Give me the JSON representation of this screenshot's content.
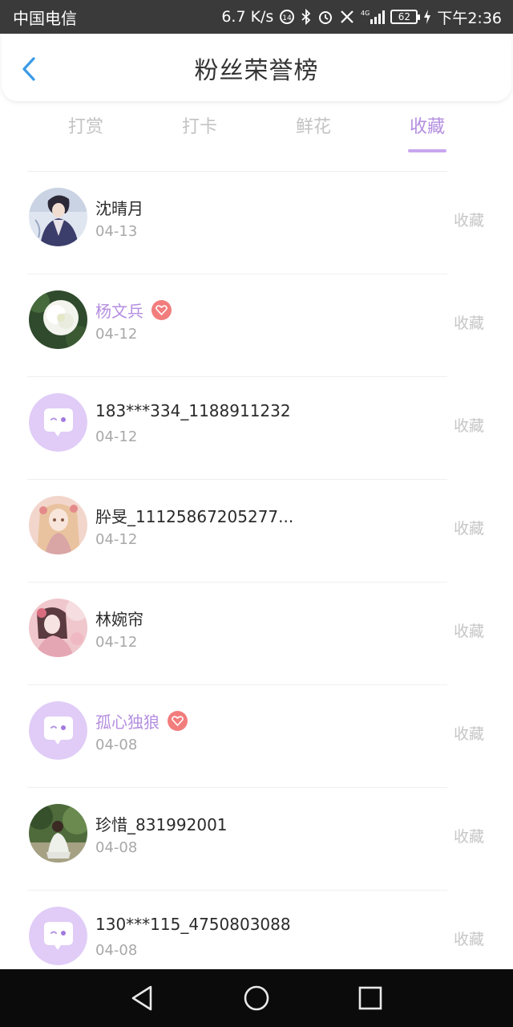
{
  "status_bar": {
    "carrier": "中国电信",
    "speed": "6.7 K/s",
    "battery": "62",
    "network": "4G",
    "time": "下午2:36"
  },
  "header": {
    "title": "粉丝荣誉榜",
    "back_icon": "back-chevron-icon"
  },
  "tabs": [
    {
      "label": "打赏",
      "active": false
    },
    {
      "label": "打卡",
      "active": false
    },
    {
      "label": "鲜花",
      "active": false
    },
    {
      "label": "收藏",
      "active": true
    }
  ],
  "list": [
    {
      "name": "沈晴月",
      "date": "04-13",
      "action": "收藏",
      "vip": false,
      "avatar": "photo-illustration-man"
    },
    {
      "name": "杨文兵",
      "date": "04-12",
      "action": "收藏",
      "vip": true,
      "avatar": "photo-white-flower"
    },
    {
      "name": "183***334_1188911232",
      "date": "04-12",
      "action": "收藏",
      "vip": false,
      "avatar": "default-chat-avatar"
    },
    {
      "name": "肸旻_11125867205277...",
      "date": "04-12",
      "action": "收藏",
      "vip": false,
      "avatar": "photo-illustration-girl"
    },
    {
      "name": "林婉帘",
      "date": "04-12",
      "action": "收藏",
      "vip": false,
      "avatar": "photo-illustration-pink"
    },
    {
      "name": "孤心独狼",
      "date": "04-08",
      "action": "收藏",
      "vip": true,
      "avatar": "default-chat-avatar"
    },
    {
      "name": "珍惜_831992001",
      "date": "04-08",
      "action": "收藏",
      "vip": false,
      "avatar": "photo-person-outdoor"
    },
    {
      "name": "130***115_4750803088",
      "date": "04-08",
      "action": "收藏",
      "vip": false,
      "avatar": "default-chat-avatar"
    }
  ],
  "colors": {
    "accent": "#b48ee0",
    "indicator": "#c9a6ee",
    "badge": "#f27d7d",
    "back": "#3a9ae8"
  }
}
